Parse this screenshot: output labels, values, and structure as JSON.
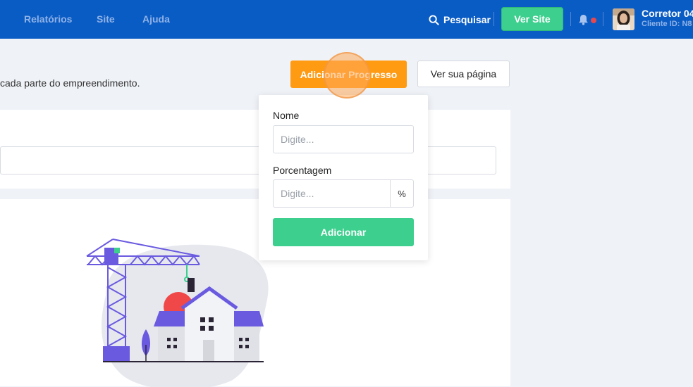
{
  "nav": {
    "items": [
      "Relatórios",
      "Site",
      "Ajuda"
    ],
    "search_label": "Pesquisar",
    "ver_site_label": "Ver Site"
  },
  "user": {
    "name": "Corretor 04",
    "client_id": "Cliente ID: N8"
  },
  "page": {
    "subtitle": "cada parte do empreendimento.",
    "add_progress_label": "Adicionar Progresso",
    "view_page_label": "Ver sua página"
  },
  "popover": {
    "name_label": "Nome",
    "name_placeholder": "Digite...",
    "percent_label": "Porcentagem",
    "percent_placeholder": "Digite...",
    "percent_suffix": "%",
    "submit_label": "Adicionar"
  },
  "icons": {
    "search": "search-icon",
    "bell": "bell-icon",
    "notification": "notification-dot-icon"
  },
  "colors": {
    "header": "#0a5cc5",
    "primary_green": "#3ccf8e",
    "accent_orange": "#ff9a13",
    "alert_red": "#e5484d",
    "illustration_purple": "#6a5ae0"
  }
}
